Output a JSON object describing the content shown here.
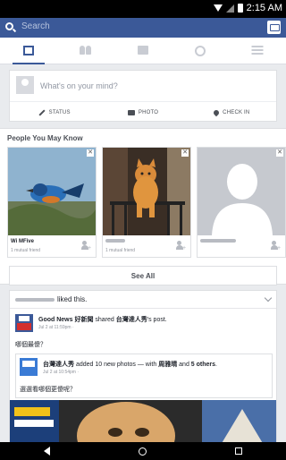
{
  "status_bar": {
    "time": "2:15 AM"
  },
  "search": {
    "placeholder": "Search"
  },
  "tabs": [
    "news-feed",
    "friends",
    "messages",
    "notifications",
    "more"
  ],
  "composer": {
    "prompt": "What's on your mind?",
    "actions": [
      {
        "icon": "pencil-icon",
        "label": "STATUS"
      },
      {
        "icon": "camera-icon",
        "label": "PHOTO"
      },
      {
        "icon": "location-pin-icon",
        "label": "CHECK IN"
      }
    ]
  },
  "pymk": {
    "title": "People You May Know",
    "cards": [
      {
        "name": "Wi MFive",
        "mutual": "1 mutual friend"
      },
      {
        "name": "",
        "mutual": "1 mutual friend"
      },
      {
        "name": "",
        "mutual": ""
      }
    ],
    "see_all": "See All"
  },
  "story": {
    "liked_suffix": "liked this.",
    "page_name": "Good News 好新聞",
    "shared_word": "shared",
    "target_page": "台灣達人秀",
    "post_word": "'s post.",
    "meta": "Jul 2 at 11:59pm · ",
    "body": "哪個最傻？",
    "shared_post": {
      "author": "台灣達人秀",
      "middle": "added 10 new photos — with",
      "tag1": "周雅晴",
      "and": "and",
      "tag2": "5 others",
      "end": ".",
      "meta": "Jul 2 at 10:54pm · ",
      "text": "選選看哪個更傻呢？"
    }
  },
  "colors": {
    "brand": "#3b5998",
    "background": "#e9ebee"
  }
}
